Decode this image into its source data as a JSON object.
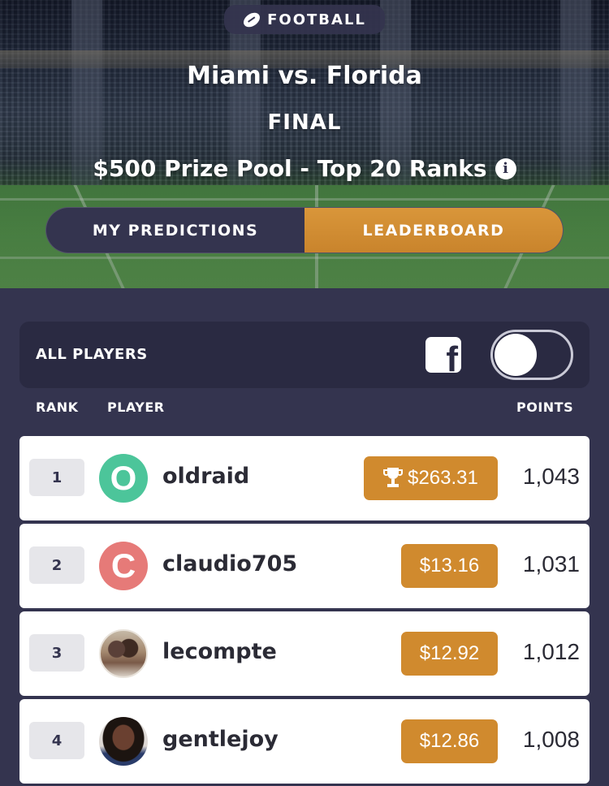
{
  "header": {
    "sport_label": "FOOTBALL",
    "sport_icon": "football-icon",
    "match_title": "Miami vs. Florida",
    "status": "FINAL",
    "prize_text": "$500 Prize Pool - Top 20 Ranks",
    "info_icon": "info-icon"
  },
  "tabs": [
    {
      "label": "MY PREDICTIONS",
      "active": false
    },
    {
      "label": "LEADERBOARD",
      "active": true
    }
  ],
  "filter": {
    "label": "ALL PLAYERS",
    "social_icon": "facebook-icon",
    "toggle_on": false
  },
  "columns": {
    "rank": "RANK",
    "player": "PLAYER",
    "points": "POINTS"
  },
  "rows": [
    {
      "rank": "1",
      "avatar_initial": "O",
      "avatar_color": "#4cc59a",
      "username": "oldraid",
      "prize": "$263.31",
      "trophy": true,
      "points": "1,043"
    },
    {
      "rank": "2",
      "avatar_initial": "C",
      "avatar_color": "#e67a78",
      "username": "claudio705",
      "prize": "$13.16",
      "trophy": false,
      "points": "1,031"
    },
    {
      "rank": "3",
      "avatar_initial": "",
      "avatar_color": "",
      "username": "lecompte",
      "prize": "$12.92",
      "trophy": false,
      "points": "1,012"
    },
    {
      "rank": "4",
      "avatar_initial": "",
      "avatar_color": "",
      "username": "gentlejoy",
      "prize": "$12.86",
      "trophy": false,
      "points": "1,008"
    }
  ],
  "colors": {
    "accent": "#d08a2e",
    "background": "#34344f",
    "panel": "#2a2a42"
  }
}
